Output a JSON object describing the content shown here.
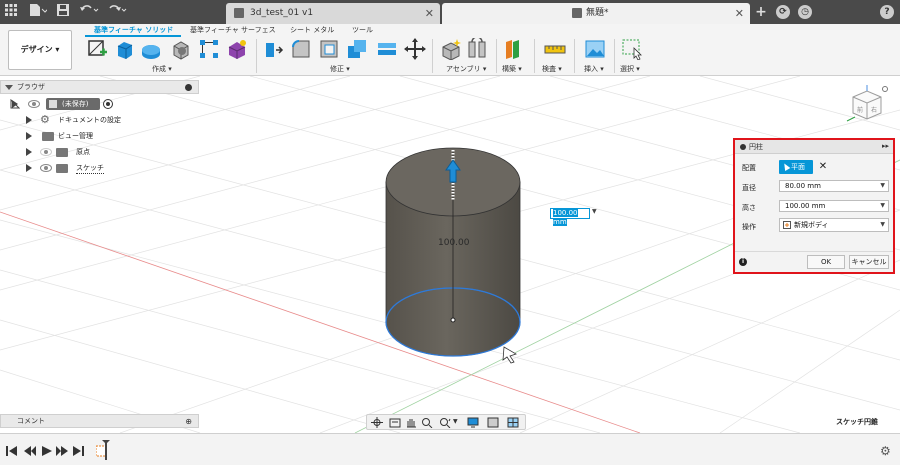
{
  "titlebar": {
    "tabs": [
      {
        "label": "3d_test_01 v1",
        "active": false
      },
      {
        "label": "無題*",
        "active": true
      }
    ],
    "add_tab": "+",
    "help": "?"
  },
  "ribbon": {
    "design_button": "デザイン ▾",
    "tabs": [
      "基準フィーチャ ソリッド",
      "基準フィーチャ サーフェス",
      "シート メタル",
      "ツール"
    ],
    "groups": {
      "create": "作成 ▾",
      "modify": "修正 ▾",
      "assemble": "アセンブリ ▾",
      "construct": "構築 ▾",
      "inspect": "検査 ▾",
      "insert": "挿入 ▾",
      "select": "選択 ▾"
    }
  },
  "browser": {
    "title": "ブラウザ",
    "items": [
      {
        "label": "(未保存)"
      },
      {
        "label": "ドキュメントの設定"
      },
      {
        "label": "ビュー管理"
      },
      {
        "label": "原点"
      },
      {
        "label": "スケッチ"
      }
    ]
  },
  "viewport": {
    "dimension_label": "100.00",
    "dimension_input": "100.00 mm",
    "viewcube": {
      "front": "前",
      "right": "右"
    }
  },
  "dialog": {
    "title": "円柱",
    "placement_label": "配置",
    "placement_button": "平面",
    "diameter_label": "直径",
    "diameter_value": "80.00 mm",
    "height_label": "高さ",
    "height_value": "100.00 mm",
    "operation_label": "操作",
    "operation_value": "新規ボディ",
    "ok": "OK",
    "cancel": "キャンセル"
  },
  "comments": {
    "title": "コメント"
  },
  "status": {
    "sketch_label": "スケッチ円錐"
  },
  "colors": {
    "accent": "#0696d7",
    "dialog_highlight": "#e0141b",
    "cylinder": "#615d55"
  }
}
